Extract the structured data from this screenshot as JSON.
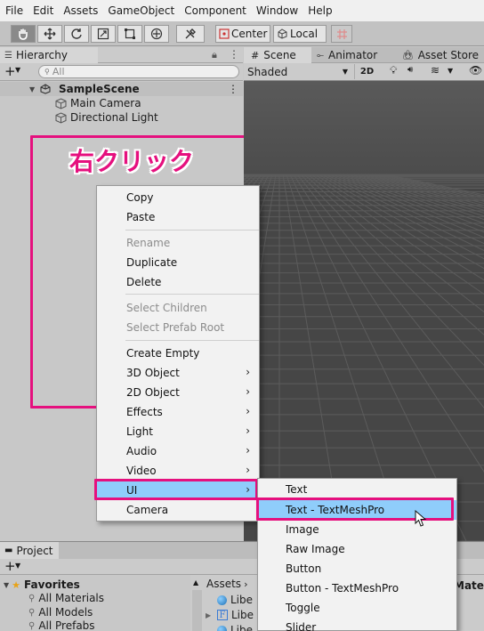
{
  "menubar": {
    "items": [
      "File",
      "Edit",
      "Assets",
      "GameObject",
      "Component",
      "Window",
      "Help"
    ]
  },
  "toolbar": {
    "pivot_label": "Center",
    "space_label": "Local"
  },
  "hierarchy": {
    "tab_label": "Hierarchy",
    "search_placeholder": "All",
    "scene_name": "SampleScene",
    "objects": [
      "Main Camera",
      "Directional Light"
    ]
  },
  "annotation": {
    "text": "右クリック",
    "color": "#e5107e"
  },
  "scene": {
    "tabs": [
      "Scene",
      "Animator",
      "Asset Store"
    ],
    "shading_mode": "Shaded",
    "toggle_2d": "2D"
  },
  "context_menu": {
    "items": [
      {
        "label": "Copy"
      },
      {
        "label": "Paste"
      },
      {
        "label": "Rename"
      },
      {
        "label": "Duplicate"
      },
      {
        "label": "Delete"
      },
      {
        "label": "Select Children"
      },
      {
        "label": "Select Prefab Root"
      },
      {
        "label": "Create Empty"
      },
      {
        "label": "3D Object"
      },
      {
        "label": "2D Object"
      },
      {
        "label": "Effects"
      },
      {
        "label": "Light"
      },
      {
        "label": "Audio"
      },
      {
        "label": "Video"
      },
      {
        "label": "UI"
      },
      {
        "label": "Camera"
      }
    ]
  },
  "ui_submenu": {
    "items": [
      "Text",
      "Text - TextMeshPro",
      "Image",
      "Raw Image",
      "Button",
      "Button - TextMeshPro",
      "Toggle",
      "Slider"
    ]
  },
  "project": {
    "tab_label": "Project",
    "favorites_label": "Favorites",
    "favorites": [
      "All Materials",
      "All Models",
      "All Prefabs"
    ],
    "breadcrumb_assets": "Assets",
    "asset_items": [
      "Libe",
      "Libe",
      "Libe"
    ],
    "materials_partial": "Materi"
  },
  "colors": {
    "highlight": "#e5107e",
    "selection": "#8fcdfb",
    "scene_bg": "#474747"
  }
}
